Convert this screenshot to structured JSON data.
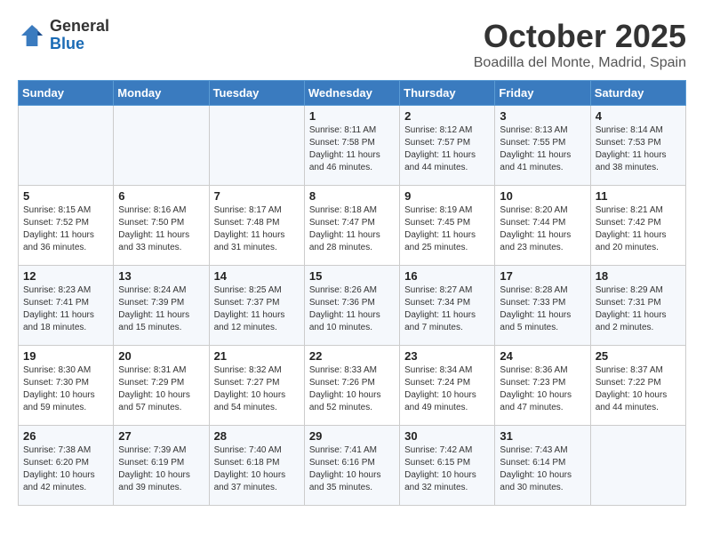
{
  "logo": {
    "general": "General",
    "blue": "Blue"
  },
  "header": {
    "month": "October 2025",
    "location": "Boadilla del Monte, Madrid, Spain"
  },
  "weekdays": [
    "Sunday",
    "Monday",
    "Tuesday",
    "Wednesday",
    "Thursday",
    "Friday",
    "Saturday"
  ],
  "weeks": [
    [
      {
        "day": "",
        "sunrise": "",
        "sunset": "",
        "daylight": ""
      },
      {
        "day": "",
        "sunrise": "",
        "sunset": "",
        "daylight": ""
      },
      {
        "day": "",
        "sunrise": "",
        "sunset": "",
        "daylight": ""
      },
      {
        "day": "1",
        "sunrise": "Sunrise: 8:11 AM",
        "sunset": "Sunset: 7:58 PM",
        "daylight": "Daylight: 11 hours and 46 minutes."
      },
      {
        "day": "2",
        "sunrise": "Sunrise: 8:12 AM",
        "sunset": "Sunset: 7:57 PM",
        "daylight": "Daylight: 11 hours and 44 minutes."
      },
      {
        "day": "3",
        "sunrise": "Sunrise: 8:13 AM",
        "sunset": "Sunset: 7:55 PM",
        "daylight": "Daylight: 11 hours and 41 minutes."
      },
      {
        "day": "4",
        "sunrise": "Sunrise: 8:14 AM",
        "sunset": "Sunset: 7:53 PM",
        "daylight": "Daylight: 11 hours and 38 minutes."
      }
    ],
    [
      {
        "day": "5",
        "sunrise": "Sunrise: 8:15 AM",
        "sunset": "Sunset: 7:52 PM",
        "daylight": "Daylight: 11 hours and 36 minutes."
      },
      {
        "day": "6",
        "sunrise": "Sunrise: 8:16 AM",
        "sunset": "Sunset: 7:50 PM",
        "daylight": "Daylight: 11 hours and 33 minutes."
      },
      {
        "day": "7",
        "sunrise": "Sunrise: 8:17 AM",
        "sunset": "Sunset: 7:48 PM",
        "daylight": "Daylight: 11 hours and 31 minutes."
      },
      {
        "day": "8",
        "sunrise": "Sunrise: 8:18 AM",
        "sunset": "Sunset: 7:47 PM",
        "daylight": "Daylight: 11 hours and 28 minutes."
      },
      {
        "day": "9",
        "sunrise": "Sunrise: 8:19 AM",
        "sunset": "Sunset: 7:45 PM",
        "daylight": "Daylight: 11 hours and 25 minutes."
      },
      {
        "day": "10",
        "sunrise": "Sunrise: 8:20 AM",
        "sunset": "Sunset: 7:44 PM",
        "daylight": "Daylight: 11 hours and 23 minutes."
      },
      {
        "day": "11",
        "sunrise": "Sunrise: 8:21 AM",
        "sunset": "Sunset: 7:42 PM",
        "daylight": "Daylight: 11 hours and 20 minutes."
      }
    ],
    [
      {
        "day": "12",
        "sunrise": "Sunrise: 8:23 AM",
        "sunset": "Sunset: 7:41 PM",
        "daylight": "Daylight: 11 hours and 18 minutes."
      },
      {
        "day": "13",
        "sunrise": "Sunrise: 8:24 AM",
        "sunset": "Sunset: 7:39 PM",
        "daylight": "Daylight: 11 hours and 15 minutes."
      },
      {
        "day": "14",
        "sunrise": "Sunrise: 8:25 AM",
        "sunset": "Sunset: 7:37 PM",
        "daylight": "Daylight: 11 hours and 12 minutes."
      },
      {
        "day": "15",
        "sunrise": "Sunrise: 8:26 AM",
        "sunset": "Sunset: 7:36 PM",
        "daylight": "Daylight: 11 hours and 10 minutes."
      },
      {
        "day": "16",
        "sunrise": "Sunrise: 8:27 AM",
        "sunset": "Sunset: 7:34 PM",
        "daylight": "Daylight: 11 hours and 7 minutes."
      },
      {
        "day": "17",
        "sunrise": "Sunrise: 8:28 AM",
        "sunset": "Sunset: 7:33 PM",
        "daylight": "Daylight: 11 hours and 5 minutes."
      },
      {
        "day": "18",
        "sunrise": "Sunrise: 8:29 AM",
        "sunset": "Sunset: 7:31 PM",
        "daylight": "Daylight: 11 hours and 2 minutes."
      }
    ],
    [
      {
        "day": "19",
        "sunrise": "Sunrise: 8:30 AM",
        "sunset": "Sunset: 7:30 PM",
        "daylight": "Daylight: 10 hours and 59 minutes."
      },
      {
        "day": "20",
        "sunrise": "Sunrise: 8:31 AM",
        "sunset": "Sunset: 7:29 PM",
        "daylight": "Daylight: 10 hours and 57 minutes."
      },
      {
        "day": "21",
        "sunrise": "Sunrise: 8:32 AM",
        "sunset": "Sunset: 7:27 PM",
        "daylight": "Daylight: 10 hours and 54 minutes."
      },
      {
        "day": "22",
        "sunrise": "Sunrise: 8:33 AM",
        "sunset": "Sunset: 7:26 PM",
        "daylight": "Daylight: 10 hours and 52 minutes."
      },
      {
        "day": "23",
        "sunrise": "Sunrise: 8:34 AM",
        "sunset": "Sunset: 7:24 PM",
        "daylight": "Daylight: 10 hours and 49 minutes."
      },
      {
        "day": "24",
        "sunrise": "Sunrise: 8:36 AM",
        "sunset": "Sunset: 7:23 PM",
        "daylight": "Daylight: 10 hours and 47 minutes."
      },
      {
        "day": "25",
        "sunrise": "Sunrise: 8:37 AM",
        "sunset": "Sunset: 7:22 PM",
        "daylight": "Daylight: 10 hours and 44 minutes."
      }
    ],
    [
      {
        "day": "26",
        "sunrise": "Sunrise: 7:38 AM",
        "sunset": "Sunset: 6:20 PM",
        "daylight": "Daylight: 10 hours and 42 minutes."
      },
      {
        "day": "27",
        "sunrise": "Sunrise: 7:39 AM",
        "sunset": "Sunset: 6:19 PM",
        "daylight": "Daylight: 10 hours and 39 minutes."
      },
      {
        "day": "28",
        "sunrise": "Sunrise: 7:40 AM",
        "sunset": "Sunset: 6:18 PM",
        "daylight": "Daylight: 10 hours and 37 minutes."
      },
      {
        "day": "29",
        "sunrise": "Sunrise: 7:41 AM",
        "sunset": "Sunset: 6:16 PM",
        "daylight": "Daylight: 10 hours and 35 minutes."
      },
      {
        "day": "30",
        "sunrise": "Sunrise: 7:42 AM",
        "sunset": "Sunset: 6:15 PM",
        "daylight": "Daylight: 10 hours and 32 minutes."
      },
      {
        "day": "31",
        "sunrise": "Sunrise: 7:43 AM",
        "sunset": "Sunset: 6:14 PM",
        "daylight": "Daylight: 10 hours and 30 minutes."
      },
      {
        "day": "",
        "sunrise": "",
        "sunset": "",
        "daylight": ""
      }
    ]
  ]
}
